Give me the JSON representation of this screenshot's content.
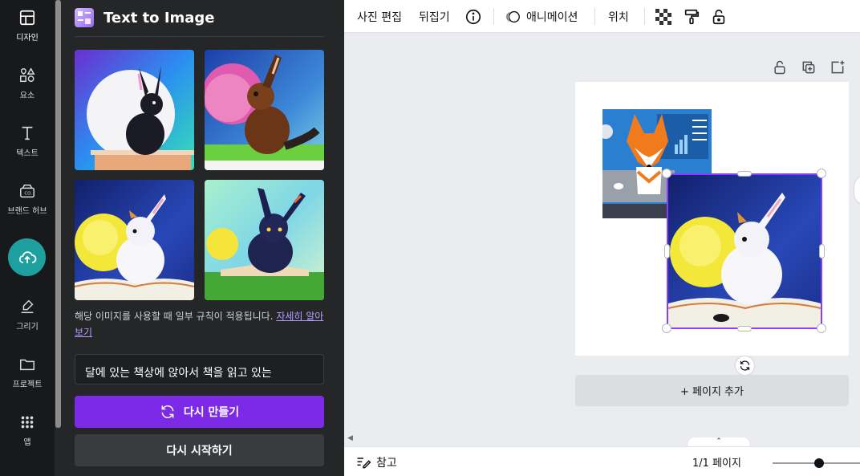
{
  "rail": {
    "items": [
      {
        "label": "디자인",
        "icon": "layout-icon"
      },
      {
        "label": "요소",
        "icon": "shapes-icon"
      },
      {
        "label": "텍스트",
        "icon": "text-icon"
      },
      {
        "label": "브랜드 허브",
        "icon": "brand-hub-icon"
      },
      {
        "label": "",
        "icon": "upload-cloud-icon"
      },
      {
        "label": "그리기",
        "icon": "draw-icon"
      },
      {
        "label": "프로젝트",
        "icon": "folder-icon"
      },
      {
        "label": "앱",
        "icon": "apps-grid-icon"
      }
    ]
  },
  "panel": {
    "title": "Text to Image",
    "notice_text": "해당 이미지를 사용할 때 일부 규칙이 적용됩니다. ",
    "notice_link": "자세히 알아보기",
    "prompt_value": "달에 있는 책상에 앉아서 책을 읽고 있는",
    "regenerate_label": "다시 만들기",
    "restart_label": "다시 시작하기",
    "images": [
      {
        "name": "black rabbit on desk with moon"
      },
      {
        "name": "brown hare with pink moon"
      },
      {
        "name": "white rabbit reading book with moon"
      },
      {
        "name": "dark rabbit reading book on grass"
      }
    ]
  },
  "toolbar": {
    "photo_edit": "사진 편집",
    "flip": "뒤집기",
    "animate": "애니메이션",
    "position": "위치"
  },
  "canvas": {
    "add_page": "+ 페이지 추가"
  },
  "bottombar": {
    "notes": "참고",
    "pager": "1/1 페이지"
  },
  "colors": {
    "accent": "#7d2ae8",
    "selection": "#8b3dff",
    "upload": "#1fa0a0"
  }
}
